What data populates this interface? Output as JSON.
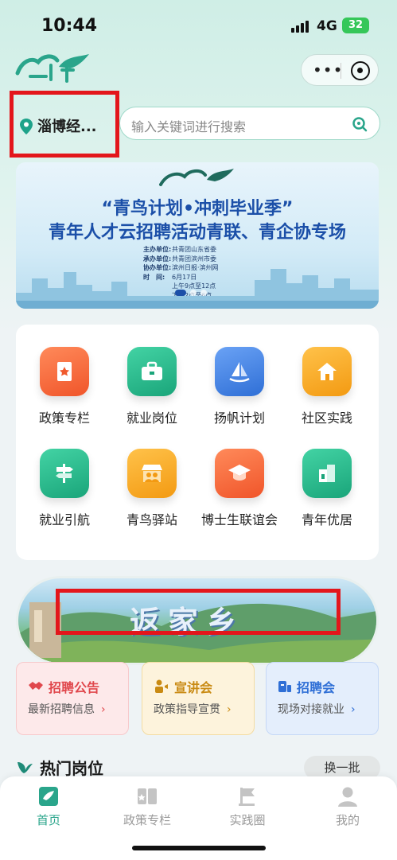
{
  "status": {
    "time": "10:44",
    "network": "4G",
    "battery": "32"
  },
  "header": {
    "logo_text": "青鸟计划"
  },
  "location": {
    "city": "淄博经..."
  },
  "search": {
    "placeholder": "输入关键词进行搜索"
  },
  "banner": {
    "logo_text": "青鸟计划",
    "title1": "“青鸟计划•冲刺毕业季”",
    "title2": "青年人才云招聘活动青联、青企协专场",
    "info": [
      {
        "k": "主办单位:",
        "v": "共青团山东省委"
      },
      {
        "k": "承办单位:",
        "v": "共青团滨州市委"
      },
      {
        "k": "协办单位:",
        "v": "滨州日报·滨州网"
      },
      {
        "k": "时　间:",
        "v": "6月17日"
      },
      {
        "k": "",
        "v": "上午9点至12点"
      },
      {
        "k": "",
        "v": "下午2点至6点"
      }
    ]
  },
  "grid": [
    {
      "label": "政策专栏",
      "icon": "policy-book-icon",
      "color": "#f26b3a"
    },
    {
      "label": "就业岗位",
      "icon": "briefcase-icon",
      "color": "#27b98d"
    },
    {
      "label": "扬帆计划",
      "icon": "sailboat-icon",
      "color": "#3f7fe6"
    },
    {
      "label": "社区实践",
      "icon": "community-house-icon",
      "color": "#f5a623"
    },
    {
      "label": "就业引航",
      "icon": "signpost-icon",
      "color": "#27b98d"
    },
    {
      "label": "青鸟驿站",
      "icon": "station-people-icon",
      "color": "#f5a623"
    },
    {
      "label": "博士生联谊会",
      "icon": "graduation-cap-icon",
      "color": "#f26b3a"
    },
    {
      "label": "青年优居",
      "icon": "apartment-icon",
      "color": "#27b98d"
    }
  ],
  "hero": {
    "text": "返家乡"
  },
  "quick": [
    {
      "title": "招聘公告",
      "sub": "最新招聘信息",
      "icon": "handshake-icon",
      "color": "#e0474c",
      "bg": "#fde9ea",
      "border": "#f7c9cb"
    },
    {
      "title": "宣讲会",
      "sub": "政策指导宣贯",
      "icon": "speaker-icon",
      "color": "#c98a12",
      "bg": "#fdf3dc",
      "border": "#f3dca2"
    },
    {
      "title": "招聘会",
      "sub": "现场对接就业",
      "icon": "job-fair-icon",
      "color": "#2f6fd6",
      "bg": "#e4eefc",
      "border": "#c5d8f6"
    }
  ],
  "hot": {
    "title": "热门岗位",
    "refresh": "换一批"
  },
  "tabs": [
    {
      "label": "首页",
      "icon": "home-bird-icon",
      "active": true
    },
    {
      "label": "政策专栏",
      "icon": "policy-book-icon",
      "active": false
    },
    {
      "label": "实践圈",
      "icon": "flag-icon",
      "active": false
    },
    {
      "label": "我的",
      "icon": "user-icon",
      "active": false
    }
  ],
  "colors": {
    "accent": "#2aa58b",
    "highlight_box": "#e3161b",
    "banner_title": "#1b4fa8"
  }
}
